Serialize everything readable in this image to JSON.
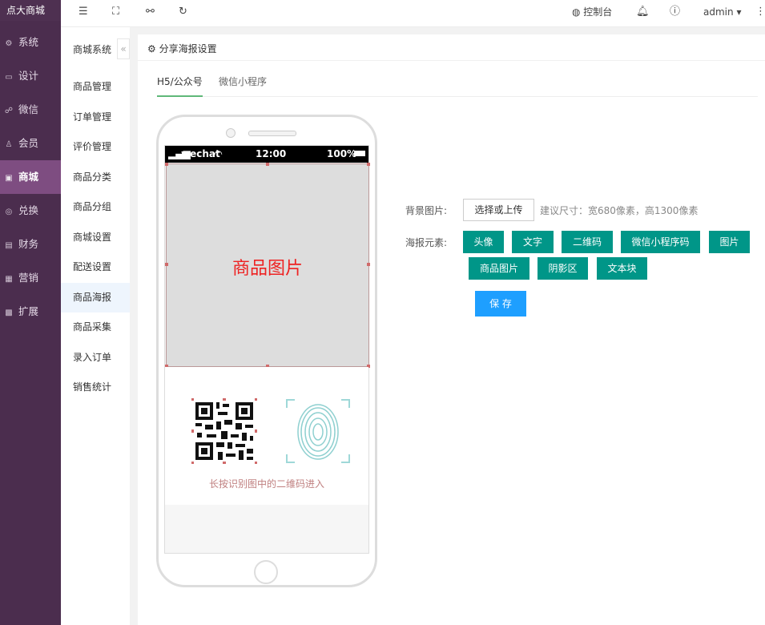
{
  "brand": "点大商城",
  "main_nav": [
    {
      "label": "系统",
      "icon": "gear-icon"
    },
    {
      "label": "设计",
      "icon": "monitor-icon"
    },
    {
      "label": "微信",
      "icon": "wechat-icon"
    },
    {
      "label": "会员",
      "icon": "user-icon"
    },
    {
      "label": "商城",
      "icon": "shop-icon",
      "active": true
    },
    {
      "label": "兑换",
      "icon": "exchange-icon"
    },
    {
      "label": "财务",
      "icon": "finance-icon"
    },
    {
      "label": "营销",
      "icon": "marketing-icon"
    },
    {
      "label": "扩展",
      "icon": "grid-icon"
    }
  ],
  "sub_nav": {
    "title": "商城系统",
    "items": [
      "商品管理",
      "订单管理",
      "评价管理",
      "商品分类",
      "商品分组",
      "商城设置",
      "配送设置",
      "商品海报",
      "商品采集",
      "录入订单",
      "销售统计"
    ],
    "active_index": 7
  },
  "header": {
    "console_label": "控制台",
    "user": "admin"
  },
  "page": {
    "title": "分享海报设置",
    "tabs": [
      "H5/公众号",
      "微信小程序"
    ],
    "active_tab": 0
  },
  "phone": {
    "carrier": "wechat",
    "time": "12:00",
    "battery": "100%",
    "goods_image_label": "商品图片",
    "qr_tip": "长按识别图中的二维码进入"
  },
  "form": {
    "bg_label": "背景图片:",
    "upload_button": "选择或上传",
    "size_hint": "建议尺寸：宽680像素，高1300像素",
    "elements_label": "海报元素:",
    "element_buttons": [
      "头像",
      "文字",
      "二维码",
      "微信小程序码",
      "图片",
      "商品图片",
      "阴影区",
      "文本块"
    ],
    "save_button": "保 存"
  },
  "colors": {
    "sidebar": "#4b2d4e",
    "sidebar_active": "#7e4d81",
    "primary_green": "#009688",
    "primary_blue": "#1e9fff",
    "tab_underline": "#5fb878"
  }
}
